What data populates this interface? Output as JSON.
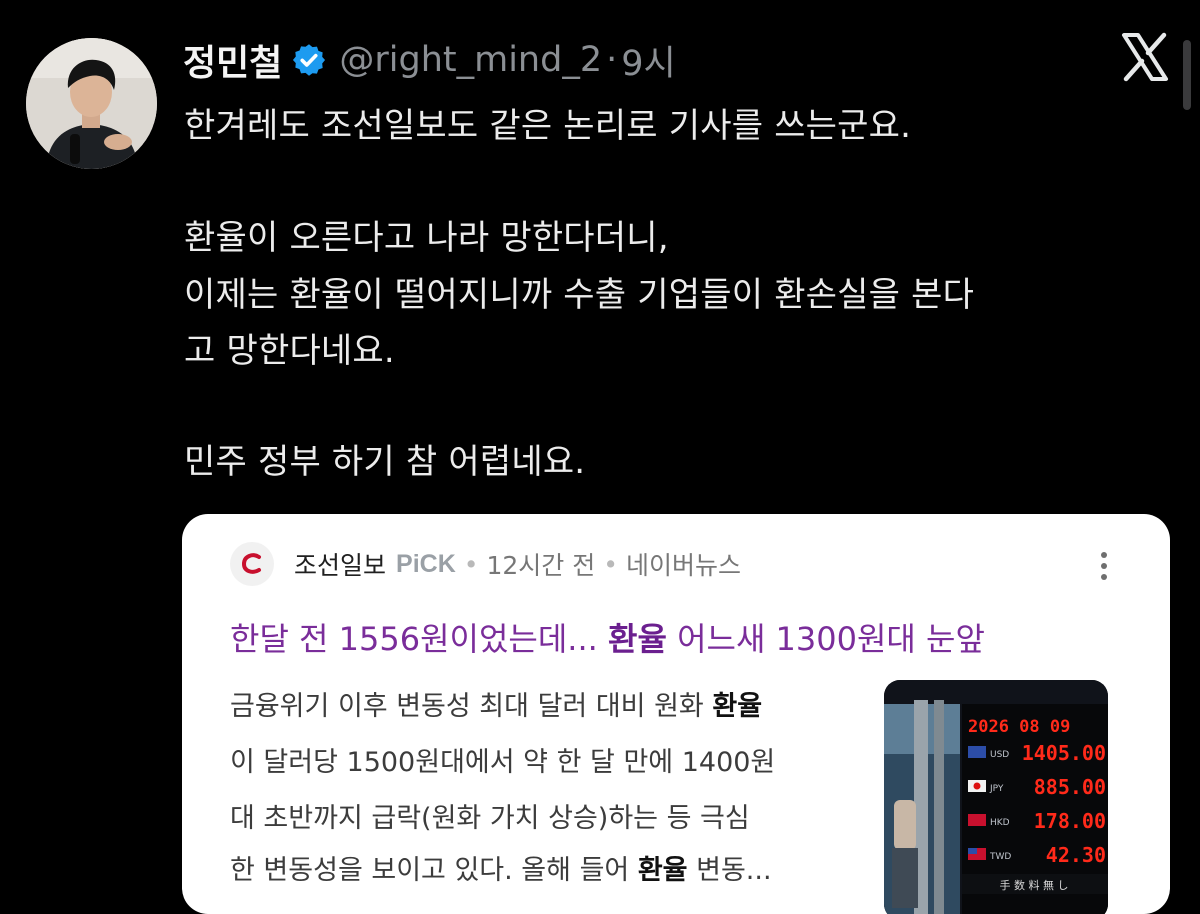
{
  "tweet": {
    "display_name": "정민철",
    "handle": "@right_mind_2",
    "separator": "·",
    "time": "9시",
    "lines": [
      "한겨레도 조선일보도 같은 논리로 기사를 쓰는군요.",
      "환율이 오른다고 나라 망한다더니,",
      "이제는 환율이 떨어지니까 수출 기업들이 환손실을 본다",
      "고 망한다네요.",
      "민주 정부 하기 참 어렵네요."
    ],
    "icons": {
      "verified": "verified-badge-icon",
      "platform": "x-logo-icon",
      "avatar": "profile-photo"
    }
  },
  "card": {
    "press_name": "조선일보",
    "pick_label": "PiCK",
    "sep": "•",
    "time_ago": "12시간 전",
    "source": "네이버뉴스",
    "headline": {
      "pre": "한달 전 1556원이었는데... ",
      "highlight": "환율",
      "post": " 어느새 1300원대 눈앞"
    },
    "snippet": [
      {
        "pre": "금융위기 이후 변동성 최대 달러 대비 원화 ",
        "bold": "환율",
        "post": ""
      },
      {
        "pre": "이 달러당 1500원대에서 약 한 달 만에 1400원",
        "bold": "",
        "post": ""
      },
      {
        "pre": "대 초반까지 급락(원화 가치 상승)하는 등 극심",
        "bold": "",
        "post": ""
      },
      {
        "pre": "한 변동성을 보이고 있다. 올해 들어 ",
        "bold": "환율",
        "post": " 변동..."
      }
    ],
    "thumbnail": {
      "date": "2026 08 09",
      "rates": [
        {
          "code": "USD",
          "value": "1405.00"
        },
        {
          "code": "JPY",
          "value": "885.00"
        },
        {
          "code": "HKD",
          "value": "178.00"
        },
        {
          "code": "TWD",
          "value": "42.30"
        }
      ],
      "footer": "手 数 料 無 し"
    }
  },
  "colors": {
    "background": "#000000",
    "verified_blue": "#1d9bf0",
    "headline_purple": "#7a2d9a",
    "press_red": "#c8102e",
    "led_red": "#ff2a1a"
  }
}
